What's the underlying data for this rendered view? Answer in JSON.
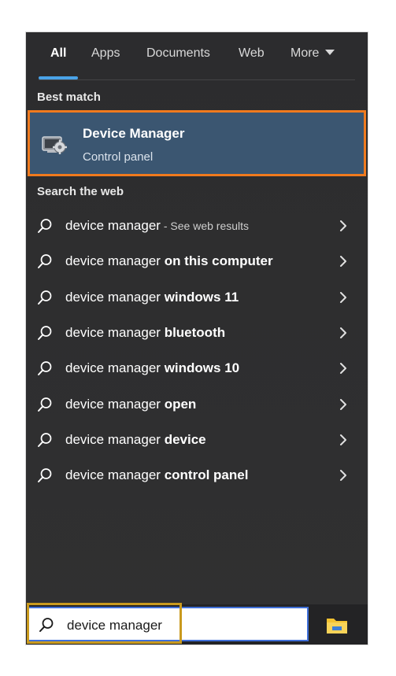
{
  "tabs": [
    "All",
    "Apps",
    "Documents",
    "Web",
    "More"
  ],
  "active_tab": "All",
  "best_match": {
    "section_title": "Best match",
    "title": "Device Manager",
    "subtitle": "Control panel",
    "icon": "device-manager-icon"
  },
  "web_section_title": "Search the web",
  "results": [
    {
      "base": "device manager",
      "bold": "",
      "hint": " - See web results"
    },
    {
      "base": "device manager",
      "bold": " on this computer",
      "hint": ""
    },
    {
      "base": "device manager",
      "bold": " windows 11",
      "hint": ""
    },
    {
      "base": "device manager",
      "bold": " bluetooth",
      "hint": ""
    },
    {
      "base": "device manager",
      "bold": " windows 10",
      "hint": ""
    },
    {
      "base": "device manager",
      "bold": " open",
      "hint": ""
    },
    {
      "base": "device manager",
      "bold": " device",
      "hint": ""
    },
    {
      "base": "device manager",
      "bold": " control panel",
      "hint": ""
    }
  ],
  "search": {
    "value": "device manager",
    "icon": "search-icon"
  },
  "taskbar_icon": "file-explorer-icon",
  "colors": {
    "accent": "#4aa3e8",
    "highlight_border": "#f07a1e",
    "search_box_border": "#c99a1e",
    "panel_bg": "#2e2e2f",
    "selected_bg": "#3b5671"
  }
}
